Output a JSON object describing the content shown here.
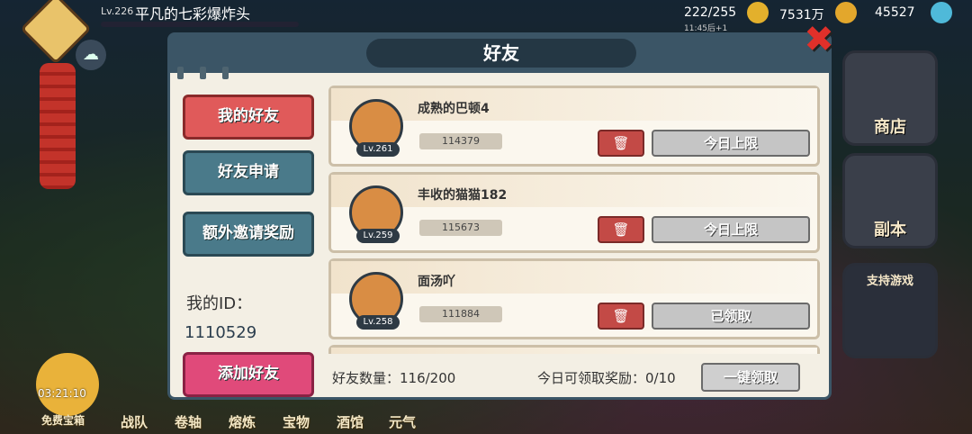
{
  "top": {
    "level": "Lv.226",
    "name": "平凡的七彩爆炸头",
    "stamina": "222/255",
    "stamina_timer": "11:45后+1",
    "gold": "7531万",
    "gems": "45527"
  },
  "left_hud": {
    "timer": "03:21:10",
    "free_label": "免费宝箱"
  },
  "bottom_nav": [
    "战队",
    "卷轴",
    "熔炼",
    "宝物",
    "酒馆",
    "元气"
  ],
  "side": {
    "shop": "商店",
    "dungeon": "副本",
    "support": "支持游戏"
  },
  "dialog": {
    "title": "好友",
    "tabs": {
      "my_friends": "我的好友",
      "requests": "好友申请",
      "invite": "额外邀请奖励",
      "add": "添加好友"
    },
    "my_id_label": "我的ID：",
    "my_id": "1110529",
    "friends": [
      {
        "name": "成熟的巴顿4",
        "level": "Lv.261",
        "id": "114379",
        "action": "今日上限"
      },
      {
        "name": "丰收的猫猫182",
        "level": "Lv.259",
        "id": "115673",
        "action": "今日上限"
      },
      {
        "name": "面汤吖",
        "level": "Lv.258",
        "id": "111884",
        "action": "已领取"
      }
    ],
    "friend_count": "好友数量：116/200",
    "reward_today": "今日可领取奖励：0/10",
    "claim_all": "一键领取"
  },
  "colors": {
    "header": "#3b5566",
    "tab_active": "#e05a5a",
    "tab_inactive": "#4a7a8a",
    "add_button": "#e04a7a",
    "delete_button": "#c34a46"
  }
}
